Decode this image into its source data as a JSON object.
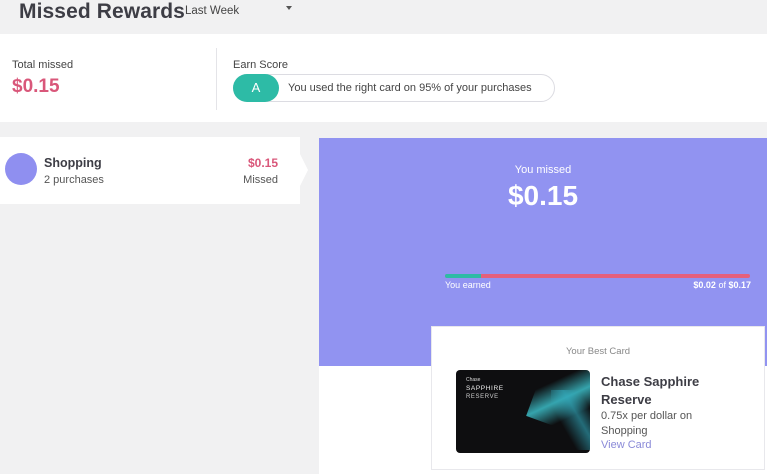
{
  "header": {
    "title": "Missed Rewards",
    "period": "Last Week"
  },
  "summary": {
    "total_label": "Total missed",
    "total_value": "$0.15",
    "earn_label": "Earn Score",
    "grade": "A",
    "grade_text": "You used the right card on 95% of your purchases"
  },
  "categories": [
    {
      "name": "Shopping",
      "sub": "2 purchases",
      "amount": "$0.15",
      "status": "Missed",
      "dot_color": "#8f8ff0"
    }
  ],
  "panel": {
    "missed_label": "You missed",
    "missed_value": "$0.15",
    "earned_label": "You earned",
    "earned_amount": "$0.02",
    "of_text": "of",
    "potential_amount": "$0.17",
    "earned_fraction": 0.118
  },
  "best_card": {
    "title": "Your Best Card",
    "card_brand": "Chase",
    "card_name_art": "SAPPHIRE",
    "card_tier_art": "RESERVE",
    "name": "Chase Sapphire Reserve",
    "rate": "0.75x per dollar on Shopping",
    "link": "View Card"
  },
  "colors": {
    "accent_pink": "#d9577a",
    "accent_teal": "#2dbba6",
    "panel_purple": "#9193f1"
  }
}
